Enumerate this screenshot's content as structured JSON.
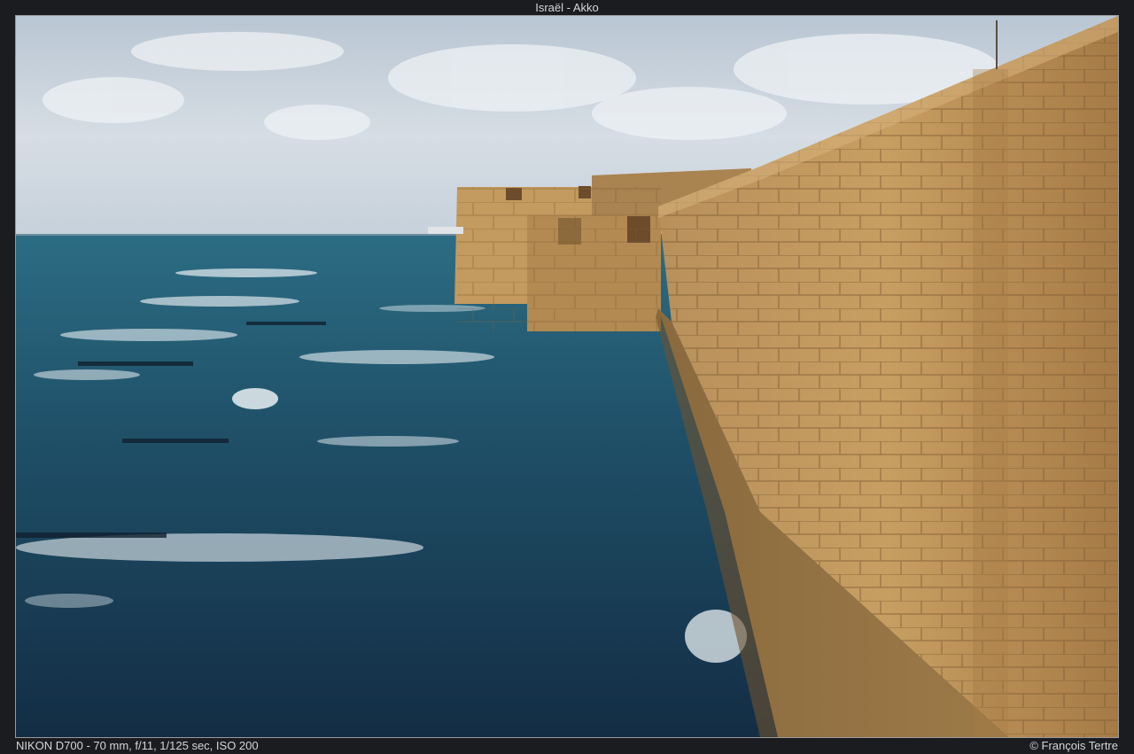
{
  "header": {
    "title": "Israël - Akko"
  },
  "photo": {
    "subject-icons": [
      "sea",
      "stone-sea-wall",
      "cloudy-sky"
    ],
    "colors": {
      "sky": "#c9d3dd",
      "sea": "#1f4a63",
      "stone": "#b58a52",
      "foam": "#e9f0f3"
    }
  },
  "footer": {
    "exif": "NIKON D700 - 70 mm, f/11, 1/125 sec, ISO 200",
    "credit": "© François Tertre"
  }
}
